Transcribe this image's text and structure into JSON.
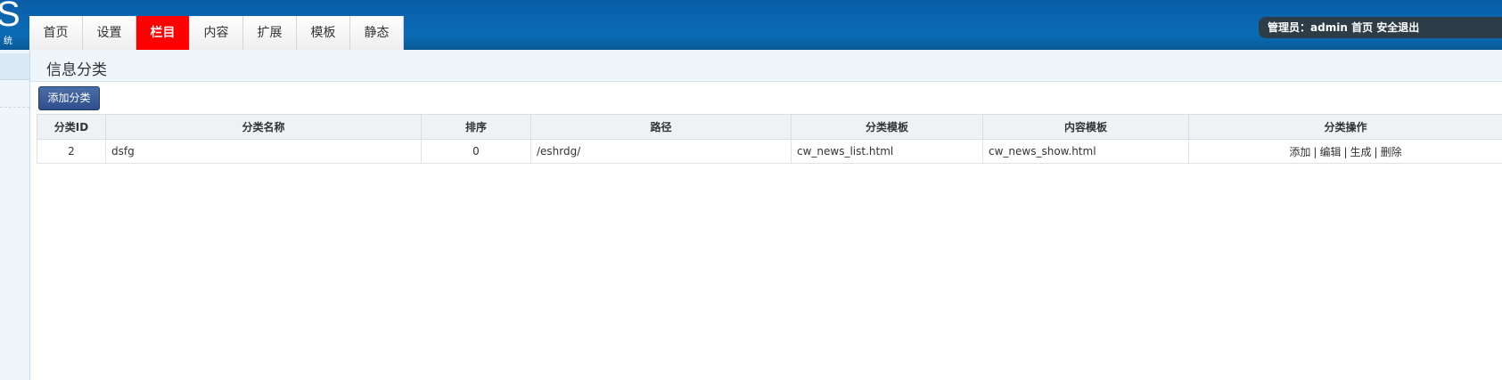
{
  "header": {
    "logo_letter": "S",
    "logo_sub": "统",
    "tabs": [
      {
        "label": "首页"
      },
      {
        "label": "设置"
      },
      {
        "label": "栏目",
        "active": true
      },
      {
        "label": "内容"
      },
      {
        "label": "扩展"
      },
      {
        "label": "模板"
      },
      {
        "label": "静态"
      }
    ],
    "user": {
      "prefix": "管理员：",
      "name": "admin",
      "home_link": "首页",
      "logout_link": "安全退出"
    }
  },
  "page": {
    "title": "信息分类",
    "add_button": "添加分类"
  },
  "table": {
    "headers": [
      "分类ID",
      "分类名称",
      "排序",
      "路径",
      "分类模板",
      "内容模板",
      "分类操作"
    ],
    "rows": [
      {
        "id": "2",
        "name": "dsfg",
        "order": "0",
        "path": "/eshrdg/",
        "list_template": "cw_news_list.html",
        "content_template": "cw_news_show.html",
        "ops": [
          "添加",
          "编辑",
          "生成",
          "删除"
        ]
      }
    ]
  },
  "colors": {
    "topbar": "#0a6bb5",
    "active_tab": "#ff0000",
    "button": "#3a5d9a"
  }
}
